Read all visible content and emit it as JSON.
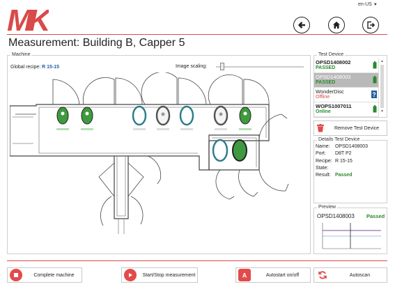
{
  "app": {
    "logo_text": "MK",
    "locale": "en-US",
    "title": "Measurement: Building B, Capper 5"
  },
  "colors": {
    "accent": "#d94a4a",
    "passed": "#2a8a2a",
    "offline": "#d94a4a",
    "online": "#2a8a2a",
    "recipe": "#1f5f9f"
  },
  "header_buttons": [
    {
      "name": "back",
      "icon": "arrow-left-icon"
    },
    {
      "name": "home",
      "icon": "home-icon"
    },
    {
      "name": "logout",
      "icon": "exit-icon"
    }
  ],
  "machine": {
    "legend": "Machine",
    "global_recipe_label": "Global recipe:",
    "global_recipe_value": "R 15-15",
    "image_scaling_label": "Image scaling:",
    "image_scaling_value": 0.05
  },
  "test_device": {
    "legend": "Test Device",
    "devices": [
      {
        "name": "OPSD1408002",
        "status": "PASSED",
        "status_color": "#2a8a2a",
        "indicator": "battery-icon",
        "selected": false
      },
      {
        "name": "OPSD1408003",
        "status": "PASSED",
        "status_color": "#2a8a2a",
        "indicator": "battery-icon",
        "selected": true
      },
      {
        "name": "WonderDisc",
        "status": "Offline",
        "status_color": "#d94a4a",
        "indicator": "question-icon",
        "selected": false
      },
      {
        "name": "WOPS1007011",
        "status": "Online",
        "status_color": "#2a8a2a",
        "indicator": "battery-icon",
        "selected": false
      }
    ],
    "remove_label": "Remove Test Device"
  },
  "details": {
    "legend": "Details Test Device",
    "name_label": "Name:",
    "name_value": "OPSD1408003",
    "port_label": "Port:",
    "port_value": "D8T P2",
    "recipe_label": "Recipe:",
    "recipe_value": "R 15-15",
    "state_label": "State:",
    "state_value": "",
    "result_label": "Result:",
    "result_value": "Passed"
  },
  "preview": {
    "legend": "Preview",
    "device": "OPSD1408003",
    "status": "Passed"
  },
  "buttons": {
    "complete_machine": "Complete machine",
    "start_stop": "Start/Stop measurement",
    "autostart": "Autostart on/off",
    "autoscan": "Autoscan"
  }
}
